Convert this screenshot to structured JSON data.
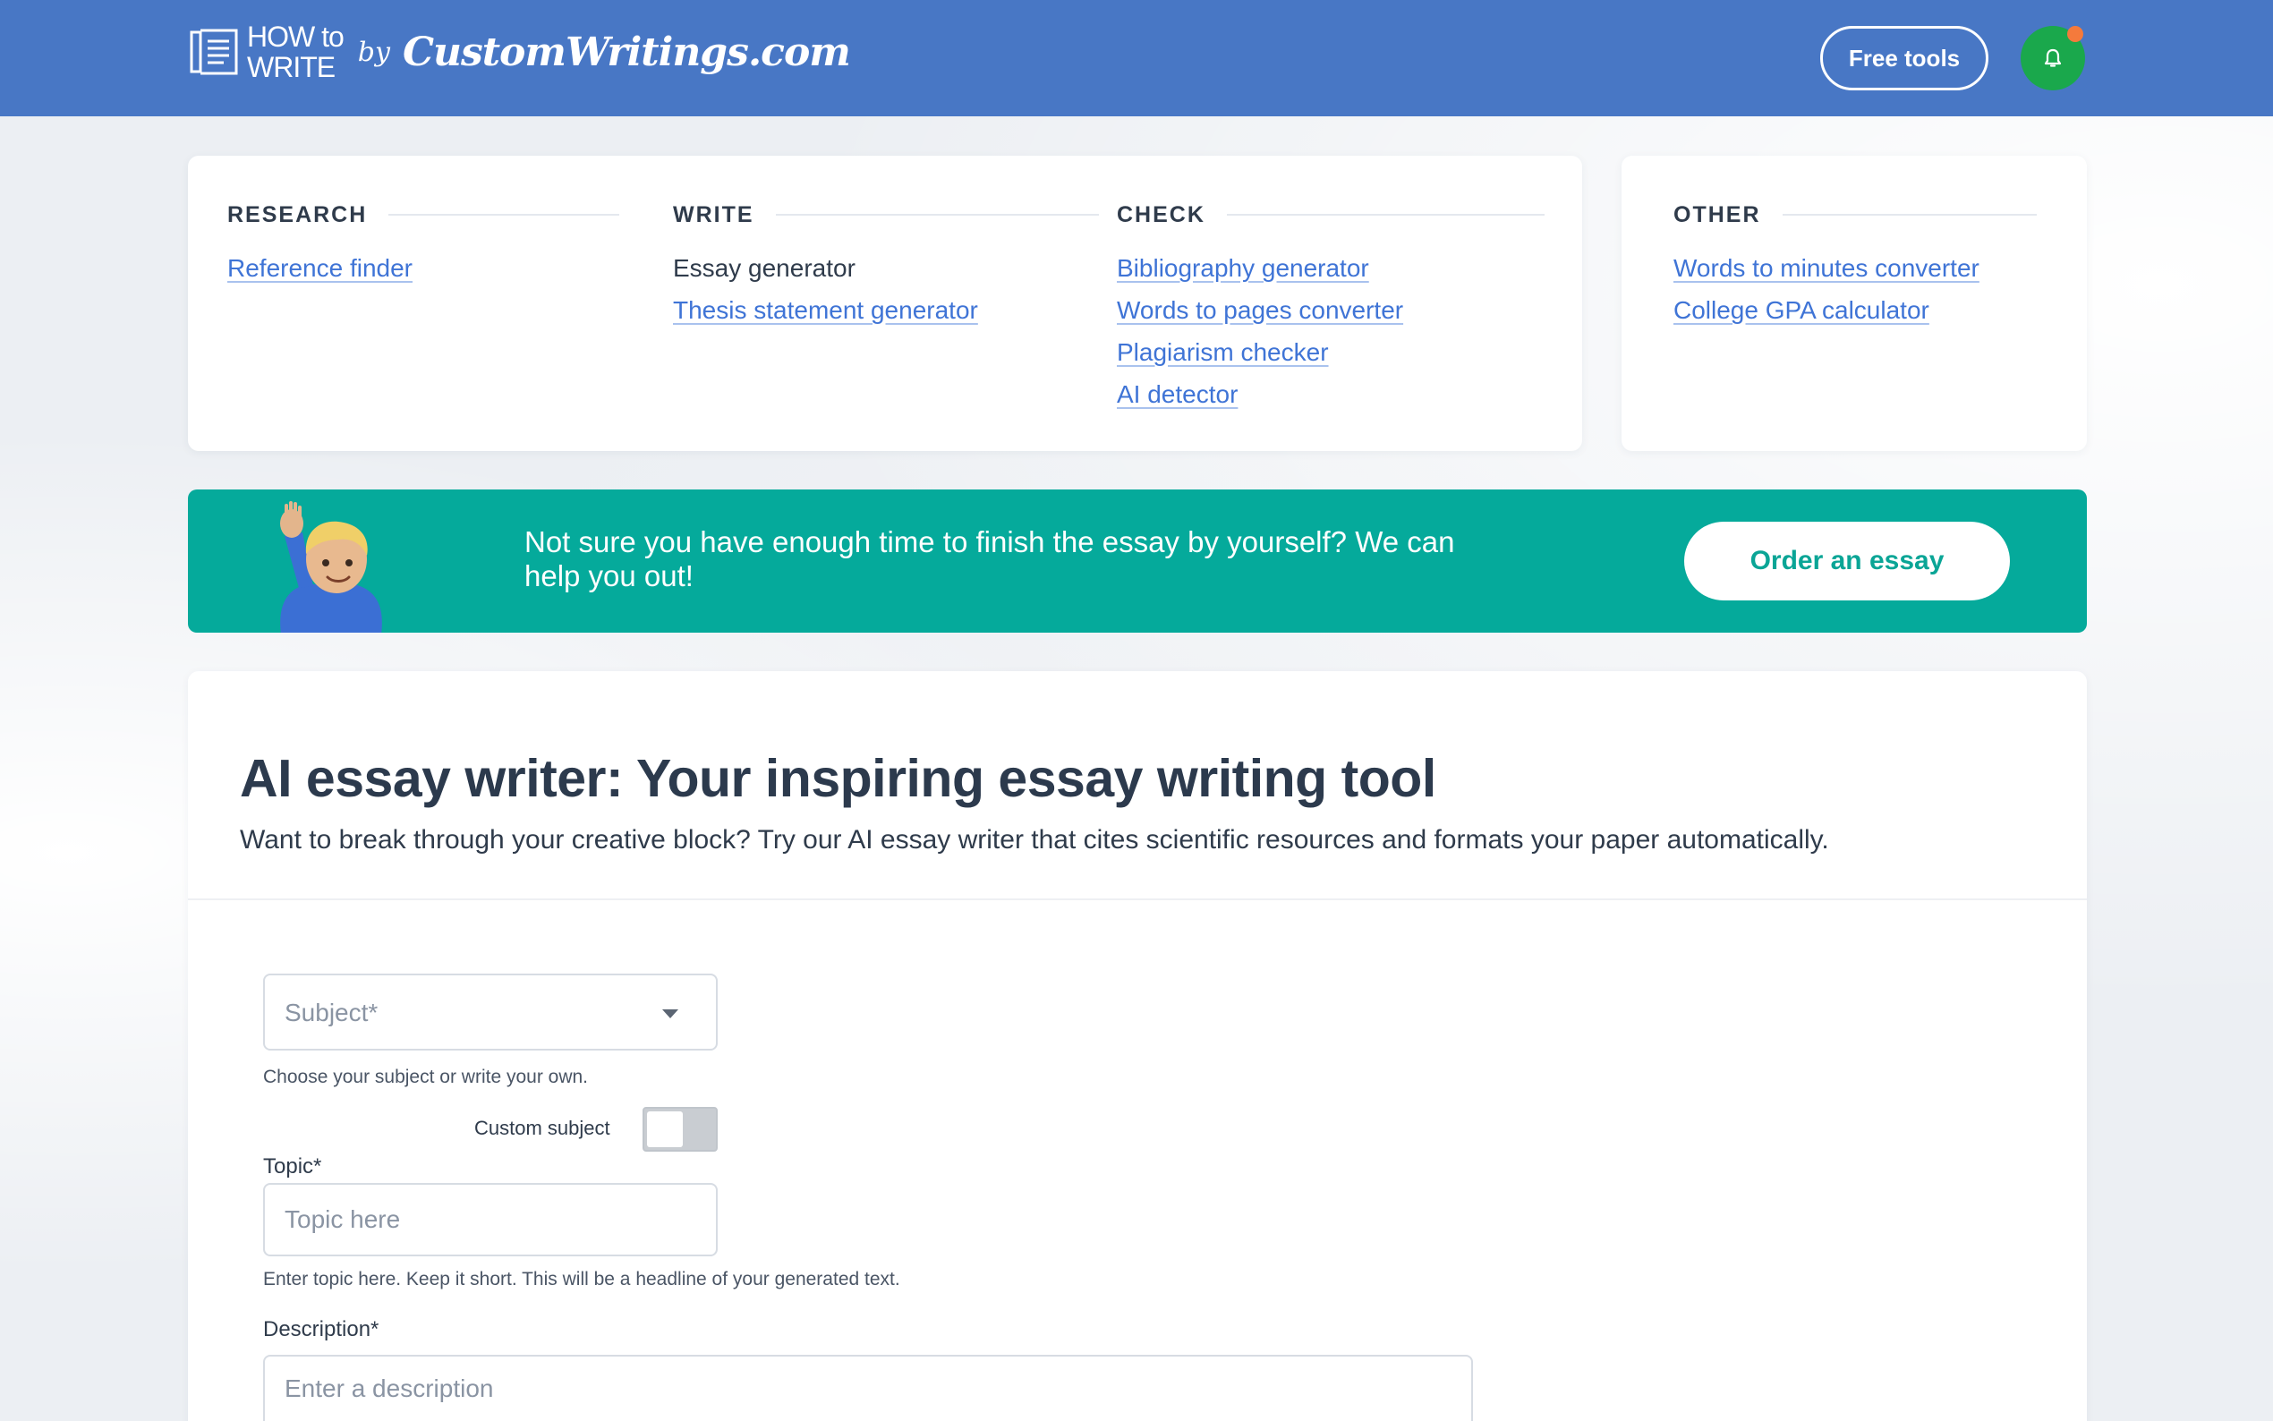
{
  "header": {
    "logo_line1": "HOW to",
    "logo_line2": "WRITE",
    "logo_by": "by",
    "logo_brand": "CustomWritings.com",
    "free_tools_label": "Free tools",
    "bell_icon": "bell-icon",
    "colors": {
      "bar": "#4877c5",
      "bell_bg": "#1aa84c",
      "notification_dot": "#f47a3c"
    }
  },
  "tools": {
    "research": {
      "heading": "RESEARCH",
      "links": [
        "Reference finder"
      ]
    },
    "write": {
      "heading": "WRITE",
      "current": "Essay generator",
      "links": [
        "Thesis statement generator"
      ]
    },
    "check": {
      "heading": "CHECK",
      "links": [
        "Bibliography generator",
        "Words to pages converter",
        "Plagiarism checker",
        "AI detector"
      ]
    },
    "other": {
      "heading": "OTHER",
      "links": [
        "Words to minutes converter",
        "College GPA calculator"
      ]
    }
  },
  "banner": {
    "text": "Not sure you have enough time to finish the essay by yourself? We can help you out!",
    "button_label": "Order an essay",
    "emoji": "raising-hand-person",
    "color": "#05aa9b"
  },
  "main": {
    "title": "AI essay writer: Your inspiring essay writing tool",
    "subtitle": "Want to break through your creative block? Try our AI essay writer that cites scientific resources and formats your paper automatically.",
    "subject": {
      "placeholder": "Subject*",
      "hint": "Choose your subject or write your own.",
      "custom_label": "Custom subject",
      "custom_enabled": false
    },
    "topic": {
      "label": "Topic*",
      "placeholder": "Topic here",
      "value": "",
      "hint": "Enter topic here. Keep it short. This will be a headline of your generated text."
    },
    "description": {
      "label": "Description*",
      "placeholder": "Enter a description",
      "value": ""
    }
  }
}
